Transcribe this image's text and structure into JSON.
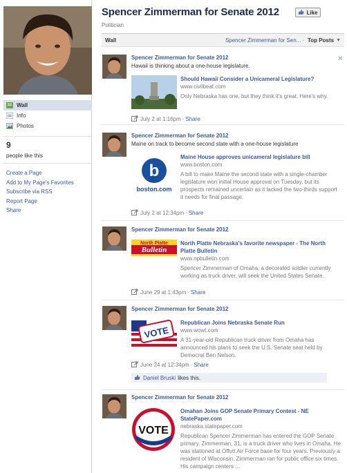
{
  "page": {
    "title": "Spencer Zimmerman for Senate 2012",
    "category": "Politician",
    "like_label": "Like"
  },
  "nav": {
    "items": [
      {
        "label": "Wall",
        "icon": "wall-icon"
      },
      {
        "label": "Info",
        "icon": "info-icon"
      },
      {
        "label": "Photos",
        "icon": "photos-icon"
      }
    ]
  },
  "likes": {
    "count": "9",
    "label": "people like this"
  },
  "links": [
    "Create a Page",
    "Add to My Page's Favorites",
    "Subscribe via RSS",
    "Report Page",
    "Share"
  ],
  "wallbar": {
    "label": "Wall",
    "filter": "Spencer Zimmerman for Sen...",
    "sort": "Top Posts"
  },
  "stories": [
    {
      "actor": "Spencer Zimmerman for Senate 2012",
      "message": "Hawaii is thinking about a one-house legislature.",
      "att_title": "Should Hawaii Consider a Unicameral Legislature?",
      "att_source": "www.civilbeat.com",
      "att_desc": "Only Nebraska has one, but they think it's great. Here's why.",
      "time": "July 2 at 1:16pm",
      "share": "Share"
    },
    {
      "actor": "Spencer Zimmerman for Senate 2012",
      "message": "Maine on track to become second state with a one-house legislature",
      "att_title": "Maine House approves unicameral legislature bill",
      "att_source": "www.boston.com",
      "att_desc": "A bill to make Maine the second state with a single-chamber legislature won initial House approval on Tuesday, but its prospects remained uncertain as it lacked the two-thirds support it needs for final passage.",
      "att_image_text": "boston.com",
      "time": "July 2 at 12:34pm",
      "share": "Share"
    },
    {
      "actor": "Spencer Zimmerman for Senate 2012",
      "message": "",
      "att_title": "North Platte Nebraska's favorite newspaper - The North Platte Bulletin",
      "att_source": "www.npbulletin.com",
      "att_desc": "Spencer Zimmerman of Omaha, a decorated soldier currently working as truck driver, will seek the United States Senate.",
      "att_image_text": "North Platte Bulletin",
      "time": "June 29 at 1:43pm",
      "share": "Share"
    },
    {
      "actor": "Spencer Zimmerman for Senate 2012",
      "message": "",
      "att_title": "Republican Joins Nebraska Senate Run",
      "att_source": "www.wowt.com",
      "att_desc": "A 31-year-old Republican truck driver from Omaha has announced his plans to seek the U.S. Senate seat held by Democrat Ben Nelson.",
      "att_image_text": "VOTE",
      "time": "June 24 at 12:34pm",
      "share": "Share",
      "liker": "Daniel Bruski",
      "likes_text": "likes this."
    },
    {
      "actor": "Spencer Zimmerman for Senate 2012",
      "message": "",
      "att_title": "Omahan Joins GOP Senate Primary Contest - NE StatePaper.com",
      "att_source": "nebraska.statepaper.com",
      "att_desc": "Republican Spencer Zimmerman has entered the GOP Senate primary. Zimmerman, 31, is a truck driver who lives in Omaha. He was stationed at Offutt Air Force base for four years. Previously a resident of Wisconsin, Zimmerman ran for public office six times. His campaign centers ...",
      "att_image_text": "VOTE"
    }
  ],
  "colors": {
    "link": "#3b5998",
    "nav_active": "#d8dfea",
    "likes_row": "#edeff4"
  }
}
